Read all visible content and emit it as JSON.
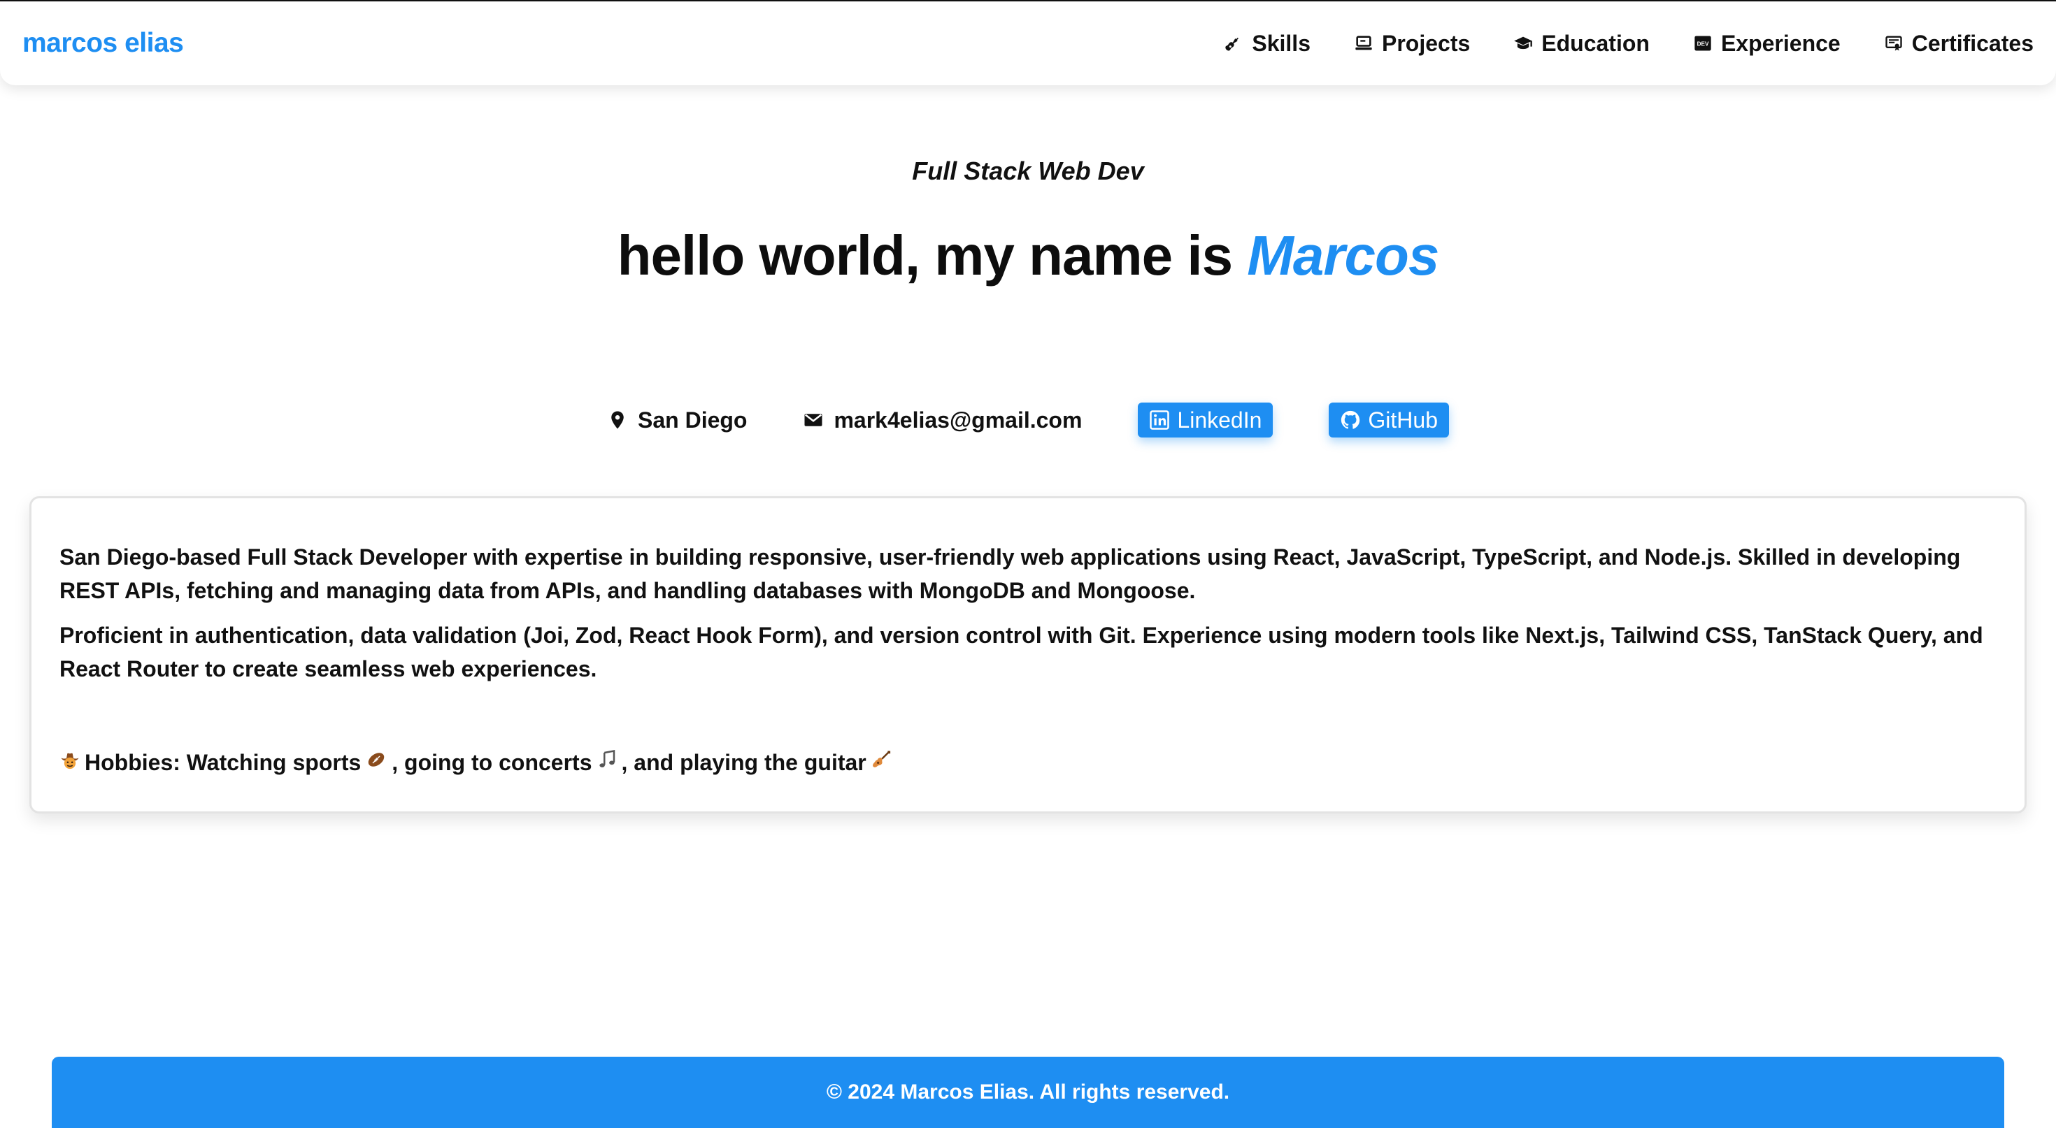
{
  "brand": "marcos elias",
  "nav": {
    "items": [
      {
        "label": "Skills",
        "icon": "guitar-icon"
      },
      {
        "label": "Projects",
        "icon": "laptop-icon"
      },
      {
        "label": "Education",
        "icon": "graduation-cap-icon"
      },
      {
        "label": "Experience",
        "icon": "dev-icon"
      },
      {
        "label": "Certificates",
        "icon": "certificate-icon"
      }
    ]
  },
  "hero": {
    "subtitle": "Full Stack Web Dev",
    "headline_prefix": "hello world, my name is ",
    "headline_name": "Marcos"
  },
  "contacts": {
    "location": "San Diego",
    "email": "mark4elias@gmail.com",
    "linkedin": "LinkedIn",
    "github": "GitHub"
  },
  "about": {
    "paragraph_1": "San Diego-based Full Stack Developer with expertise in building responsive, user-friendly web applications using React, JavaScript, TypeScript, and Node.js. Skilled in developing REST APIs, fetching and managing data from APIs, and handling databases with MongoDB and Mongoose.",
    "paragraph_2": "Proficient in authentication, data validation (Joi, Zod, React Hook Form), and version control with Git. Experience using modern tools like Next.js, Tailwind CSS, TanStack Query, and React Router to create seamless web experiences.",
    "hobbies_text": "Hobbies: Watching sports",
    "hobbies_mid": ", going to concerts",
    "hobbies_end": ", and playing the guitar"
  },
  "footer": {
    "text": "© 2024 Marcos Elias. All rights reserved."
  },
  "colors": {
    "accent": "#1e8ef2",
    "text": "#111111",
    "background": "#ffffff"
  }
}
